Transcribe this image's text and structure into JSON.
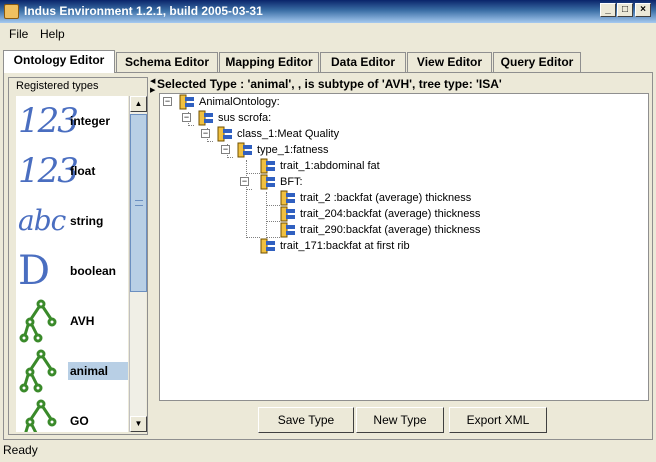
{
  "window": {
    "title": "Indus Environment 1.2.1, build 2005-03-31"
  },
  "menu": [
    "File",
    "Help"
  ],
  "tabs": [
    "Ontology Editor",
    "Schema Editor",
    "Mapping Editor",
    "Data Editor",
    "View Editor",
    "Query Editor"
  ],
  "active_tab": "Ontology Editor",
  "registered_types": {
    "legend": "Registered types",
    "items": [
      {
        "label": "integer",
        "icon": "digits-123-icon",
        "glyph": "123"
      },
      {
        "label": "float",
        "icon": "digits-123-icon",
        "glyph": "123"
      },
      {
        "label": "string",
        "icon": "letters-abc-icon",
        "glyph": "abc"
      },
      {
        "label": "boolean",
        "icon": "letter-d-icon",
        "glyph": "D"
      },
      {
        "label": "AVH",
        "icon": "tree-hierarchy-icon"
      },
      {
        "label": "animal",
        "icon": "tree-hierarchy-icon",
        "selected": true
      },
      {
        "label": "GO",
        "icon": "tree-hierarchy-icon"
      }
    ]
  },
  "selected_type_text": "Selected Type : 'animal', , is subtype of 'AVH', tree type: 'ISA'",
  "tree": {
    "nodes": [
      {
        "label": "AnimalOntology:",
        "expanded": true
      },
      {
        "label": "sus scrofa:",
        "expanded": true
      },
      {
        "label": "class_1:Meat Quality",
        "expanded": true
      },
      {
        "label": "type_1:fatness",
        "expanded": true
      },
      {
        "label": "trait_1:abdominal fat"
      },
      {
        "label": "BFT:",
        "expanded": true
      },
      {
        "label": "trait_2 :backfat (average) thickness"
      },
      {
        "label": "trait_204:backfat (average) thickness"
      },
      {
        "label": "trait_290:backfat (average) thickness"
      },
      {
        "label": "trait_171:backfat at first rib"
      }
    ]
  },
  "buttons": {
    "save": "Save Type",
    "new": "New Type",
    "export": "Export XML"
  },
  "status": "Ready",
  "colors": {
    "title_start": "#0a246a",
    "title_end": "#a6caf0",
    "selection": "#b8cfe5",
    "icon_blue": "#4a6ec0",
    "icon_green": "#3a8a2a"
  }
}
